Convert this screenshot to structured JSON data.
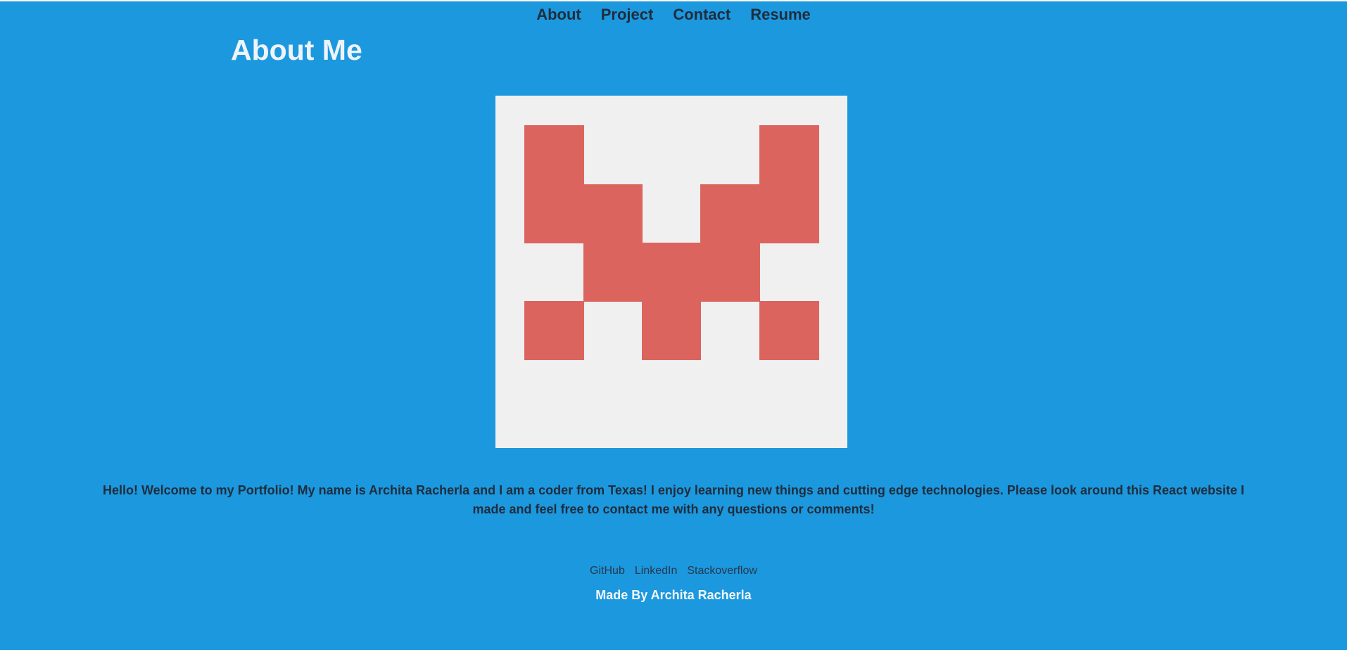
{
  "nav": {
    "items": [
      {
        "label": "About"
      },
      {
        "label": "Project"
      },
      {
        "label": "Contact"
      },
      {
        "label": "Resume"
      }
    ]
  },
  "page": {
    "title": "About Me",
    "intro": "Hello! Welcome to my Portfolio! My name is Archita Racherla and I am a coder from Texas! I enjoy learning new things and cutting edge technologies. Please look around this React website I made and feel free to contact me with any questions or comments!"
  },
  "avatar": {
    "icon": "identicon",
    "fill_color": "#dc645f",
    "background_color": "#f0f0f0"
  },
  "footer": {
    "links": [
      {
        "label": "GitHub"
      },
      {
        "label": "LinkedIn"
      },
      {
        "label": "Stackoverflow"
      }
    ],
    "credit": "Made By Archita Racherla"
  },
  "colors": {
    "page_background": "#1c98de",
    "nav_text": "#1f2d3d",
    "title_text": "#eef4fa"
  }
}
